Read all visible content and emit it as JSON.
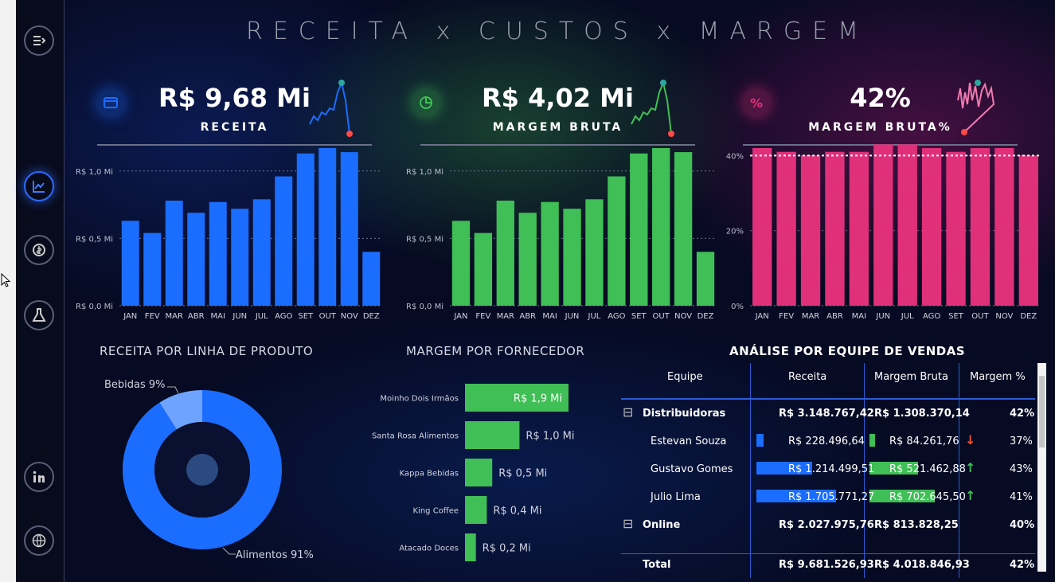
{
  "title": "RECEITA x CUSTOS x MARGEM",
  "kpis": [
    {
      "value": "R$ 9,68 Mi",
      "label": "RECEITA",
      "color": "#1b6dff",
      "icon": "wallet-icon"
    },
    {
      "value": "R$ 4,02 Mi",
      "label": "MARGEM BRUTA",
      "color": "#3fbf55",
      "icon": "pie-icon"
    },
    {
      "value": "42%",
      "label": "MARGEM BRUTA%",
      "color": "#e0307a",
      "icon": "percent-icon"
    }
  ],
  "chart_data": [
    {
      "type": "bar",
      "categories": [
        "JAN",
        "FEV",
        "MAR",
        "ABR",
        "MAI",
        "JUN",
        "JUL",
        "AGO",
        "SET",
        "OUT",
        "NOV",
        "DEZ"
      ],
      "values": [
        0.63,
        0.54,
        0.78,
        0.69,
        0.77,
        0.72,
        0.79,
        0.96,
        1.13,
        1.17,
        1.14,
        0.4
      ],
      "yticks": [
        "R$ 0,0 Mi",
        "R$ 0,5 Mi",
        "R$ 1,0 Mi"
      ],
      "ylim": [
        0,
        1.17
      ],
      "color": "#1b6dff"
    },
    {
      "type": "bar",
      "categories": [
        "JAN",
        "FEV",
        "MAR",
        "ABR",
        "MAI",
        "JUN",
        "JUL",
        "AGO",
        "SET",
        "OUT",
        "NOV",
        "DEZ"
      ],
      "values": [
        0.63,
        0.54,
        0.78,
        0.69,
        0.77,
        0.72,
        0.79,
        0.96,
        1.13,
        1.17,
        1.14,
        0.4
      ],
      "yticks": [
        "R$ 0,0 Mi",
        "R$ 0,5 Mi",
        "R$ 1,0 Mi"
      ],
      "ylim": [
        0,
        1.17
      ],
      "color": "#3fbf55"
    },
    {
      "type": "bar",
      "categories": [
        "JAN",
        "FEV",
        "MAR",
        "ABR",
        "MAI",
        "JUN",
        "JUL",
        "AGO",
        "SET",
        "OUT",
        "NOV",
        "DEZ"
      ],
      "values": [
        42,
        41,
        40,
        41,
        41,
        43,
        43,
        42,
        41,
        42,
        42,
        40
      ],
      "yticks": [
        "0%",
        "20%",
        "40%"
      ],
      "ylim": [
        0,
        42
      ],
      "reference_line": 40,
      "color": "#e0307a"
    },
    {
      "type": "pie",
      "title": "RECEITA POR LINHA DE PRODUTO",
      "slices": [
        {
          "label": "Alimentos 91%",
          "value": 91,
          "color": "#1b6dff"
        },
        {
          "label": "Bebidas 9%",
          "value": 9,
          "color": "#6ea4ff"
        }
      ]
    },
    {
      "type": "bar",
      "title": "MARGEM POR FORNECEDOR",
      "categories": [
        "Moinho Dois Irmãos",
        "Santa Rosa Alimentos",
        "Kappa Bebidas",
        "King Coffee",
        "Atacado Doces"
      ],
      "values": [
        1.9,
        1.0,
        0.5,
        0.4,
        0.2
      ],
      "labels": [
        "R$ 1,9 Mi",
        "R$ 1,0 Mi",
        "R$ 0,5 Mi",
        "R$ 0,4 Mi",
        "R$ 0,2 Mi"
      ],
      "color": "#3fbf55"
    }
  ],
  "table": {
    "title": "ANÁLISE POR EQUIPE DE VENDAS",
    "columns": [
      "Equipe",
      "Receita",
      "Margem Bruta",
      "Margem %"
    ],
    "rows": [
      {
        "name": "Distribuidoras",
        "receita": "R$ 3.148.767,42",
        "margem": "R$ 1.308.370,14",
        "pct": "42%",
        "group": true,
        "expand": "⊟"
      },
      {
        "name": "Estevan Souza",
        "receita": "R$ 228.496,64",
        "margem": "R$ 84.261,76",
        "pct": "37%",
        "rbar": 0.07,
        "mbar": 0.07,
        "arrow": "down"
      },
      {
        "name": "Gustavo Gomes",
        "receita": "R$ 1.214.499,51",
        "margem": "R$ 521.462,88",
        "pct": "43%",
        "rbar": 0.55,
        "mbar": 0.58,
        "arrow": "up"
      },
      {
        "name": "Julio Lima",
        "receita": "R$ 1.705.771,27",
        "margem": "R$ 702.645,50",
        "pct": "41%",
        "rbar": 0.78,
        "mbar": 0.78,
        "arrow": "up"
      },
      {
        "name": "Online",
        "receita": "R$ 2.027.975,76",
        "margem": "R$ 813.828,25",
        "pct": "40%",
        "group": true,
        "expand": "⊟"
      }
    ],
    "total": {
      "name": "Total",
      "receita": "R$ 9.681.526,93",
      "margem": "R$ 4.018.846,93",
      "pct": "42%"
    }
  }
}
